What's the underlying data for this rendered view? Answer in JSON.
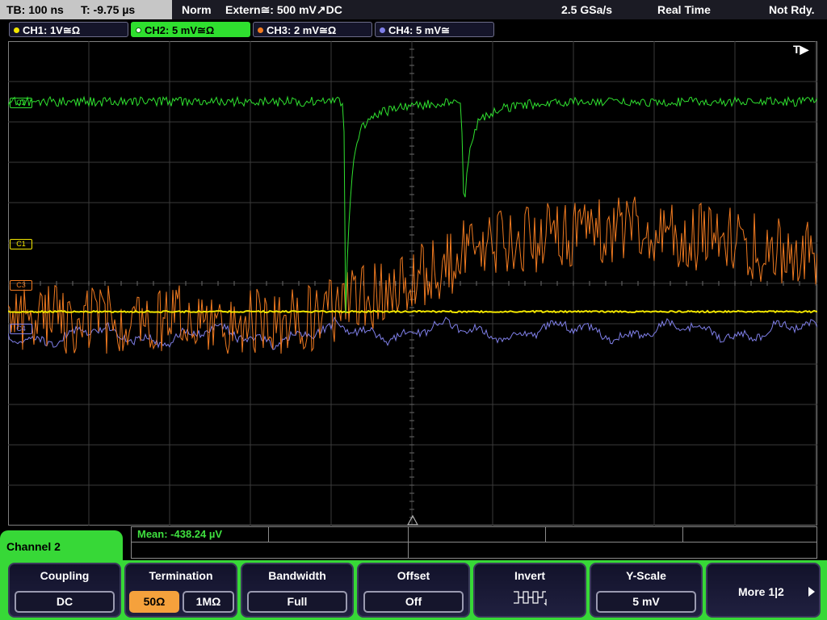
{
  "status": {
    "timebase": "TB: 100 ns",
    "trigger_time": "T: -9.75 µs",
    "mode": "Norm",
    "trigger_source": "Extern≅: 500 mV",
    "trigger_slope_coupling": "DC",
    "sample_rate": "2.5 GSa/s",
    "acquisition": "Real Time",
    "state": "Not Rdy."
  },
  "channels": [
    {
      "label": "CH1: 1V≅Ω",
      "color": "#f2e600",
      "active": false
    },
    {
      "label": "CH2: 5 mV≅Ω",
      "color": "#2fe02f",
      "active": true
    },
    {
      "label": "CH3: 2 mV≅Ω",
      "color": "#f07a20",
      "active": false
    },
    {
      "label": "CH4: 5 mV≅",
      "color": "#7f7fe8",
      "active": false
    }
  ],
  "markers": {
    "trigger_top": "T▶",
    "c1": "C1",
    "c2": "C2",
    "c3": "C3",
    "c4": "C4"
  },
  "measurement": {
    "mean": "Mean: -438.24 µV"
  },
  "menu": {
    "title": "Channel 2",
    "coupling": {
      "label": "Coupling",
      "value": "DC"
    },
    "termination": {
      "label": "Termination",
      "options": [
        "50Ω",
        "1MΩ"
      ],
      "selected": "50Ω"
    },
    "bandwidth": {
      "label": "Bandwidth",
      "value": "Full"
    },
    "offset": {
      "label": "Offset",
      "value": "Off"
    },
    "invert": {
      "label": "Invert",
      "icon": "invert-wave-icon"
    },
    "y_scale": {
      "label": "Y-Scale",
      "value": "5 mV"
    },
    "more": {
      "label": "More 1|2",
      "icon": "chevron-right-icon"
    }
  },
  "colors": {
    "ch1": "#f2e600",
    "ch2": "#2fe02f",
    "ch3": "#f07a20",
    "ch4": "#7f7fe8",
    "menu_accent": "#37d837",
    "selected_option": "#f5a13c"
  }
}
